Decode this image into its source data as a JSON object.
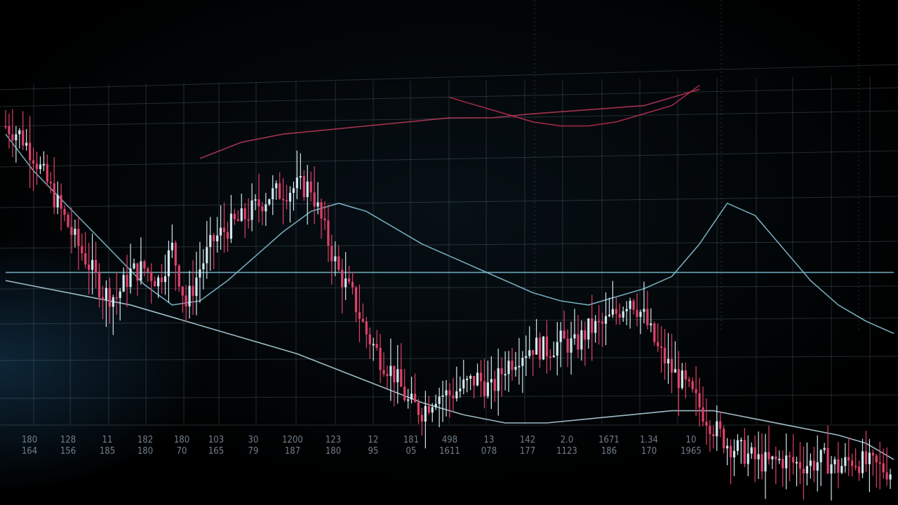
{
  "chart_data": {
    "type": "line",
    "title": "",
    "xlabel": "",
    "ylabel": "",
    "tick_labels_row1": [
      "180",
      "128",
      "11",
      "182",
      "180",
      "103",
      "30",
      "1200",
      "123",
      "12",
      "181",
      "498",
      "13",
      "142",
      "2.0",
      "1671",
      "1.34",
      "10"
    ],
    "tick_labels_row2": [
      "164",
      "156",
      "185",
      "180",
      "70",
      "165",
      "79",
      "187",
      "180",
      "95",
      "05",
      "1611",
      "078",
      "177",
      "1123",
      "186",
      "170",
      "1965"
    ],
    "ylim": [
      0,
      100
    ],
    "x": [
      0,
      1,
      2,
      3,
      4,
      5,
      6,
      7,
      8,
      9,
      10,
      11,
      12,
      13,
      14,
      15,
      16,
      17,
      18,
      19,
      20,
      21,
      22,
      23,
      24,
      25,
      26,
      27,
      28,
      29,
      30,
      31,
      32,
      33,
      34,
      35,
      36,
      37,
      38,
      39,
      40,
      41,
      42,
      43,
      44,
      45,
      46,
      47,
      48,
      49,
      50,
      51,
      52,
      53,
      54,
      55,
      56,
      57,
      58,
      59,
      60,
      61,
      62,
      63,
      64
    ],
    "series": [
      {
        "kind": "price",
        "values": [
          88,
          86,
          81,
          74,
          67,
          60,
          54,
          47,
          46,
          52,
          53,
          50,
          58,
          44,
          53,
          60,
          63,
          65,
          68,
          71,
          72,
          73,
          73,
          62,
          52,
          46,
          37,
          31,
          27,
          20,
          18,
          22,
          22,
          24,
          26,
          23,
          29,
          32,
          34,
          33,
          35,
          34,
          38,
          39,
          42,
          46,
          41,
          33,
          28,
          24,
          19,
          14,
          10,
          8,
          6,
          5,
          6,
          5,
          5,
          6,
          4,
          6,
          5,
          4,
          3
        ],
        "color_up": "#cfe8ef",
        "color_down": "#e0416b"
      },
      {
        "name": "",
        "values": [
          86,
          77,
          70,
          63,
          56,
          49,
          44,
          45,
          50,
          56,
          62,
          67,
          69,
          67,
          63,
          59,
          56,
          53,
          50,
          47,
          45,
          44,
          46,
          48,
          51,
          59,
          69,
          66,
          58,
          50,
          44,
          40,
          37
        ],
        "x": [
          0,
          2,
          4,
          6,
          8,
          10,
          12,
          14,
          16,
          18,
          20,
          22,
          24,
          26,
          28,
          30,
          32,
          34,
          36,
          38,
          40,
          42,
          44,
          46,
          48,
          50,
          52,
          54,
          56,
          58,
          60,
          62,
          64
        ],
        "color": "#86c7d8"
      },
      {
        "name": "",
        "values": [
          50,
          48,
          46,
          44,
          41,
          38,
          35,
          32,
          28,
          24,
          20,
          17,
          15,
          15,
          16,
          17,
          18,
          18,
          16,
          14,
          12,
          10,
          8,
          6
        ],
        "x": [
          0,
          3,
          6,
          9,
          12,
          15,
          18,
          21,
          24,
          27,
          30,
          33,
          36,
          39,
          42,
          45,
          48,
          51,
          54,
          57,
          60,
          62,
          63,
          64
        ],
        "color": "#b8dcea"
      },
      {
        "name": "",
        "values": [
          52,
          52,
          52,
          52,
          52,
          52,
          52,
          52,
          52,
          52,
          52,
          52,
          52,
          52
        ],
        "x": [
          0,
          5,
          10,
          15,
          20,
          25,
          30,
          35,
          40,
          45,
          50,
          55,
          60,
          64
        ],
        "color": "#7fc1d6"
      },
      {
        "name": "",
        "values": [
          80,
          84,
          86,
          87,
          88,
          89,
          90,
          90,
          91,
          92,
          93,
          97
        ],
        "x": [
          14,
          17,
          20,
          23,
          26,
          29,
          32,
          35,
          38,
          42,
          46,
          50
        ],
        "color": "#c0395a"
      },
      {
        "name": "",
        "values": [
          95,
          93,
          91,
          89,
          88,
          88,
          89,
          91,
          93,
          98
        ],
        "x": [
          32,
          34,
          36,
          38,
          40,
          42,
          44,
          46,
          48,
          50
        ],
        "color": "#b8304f"
      }
    ],
    "grid": true,
    "legend": "none"
  }
}
